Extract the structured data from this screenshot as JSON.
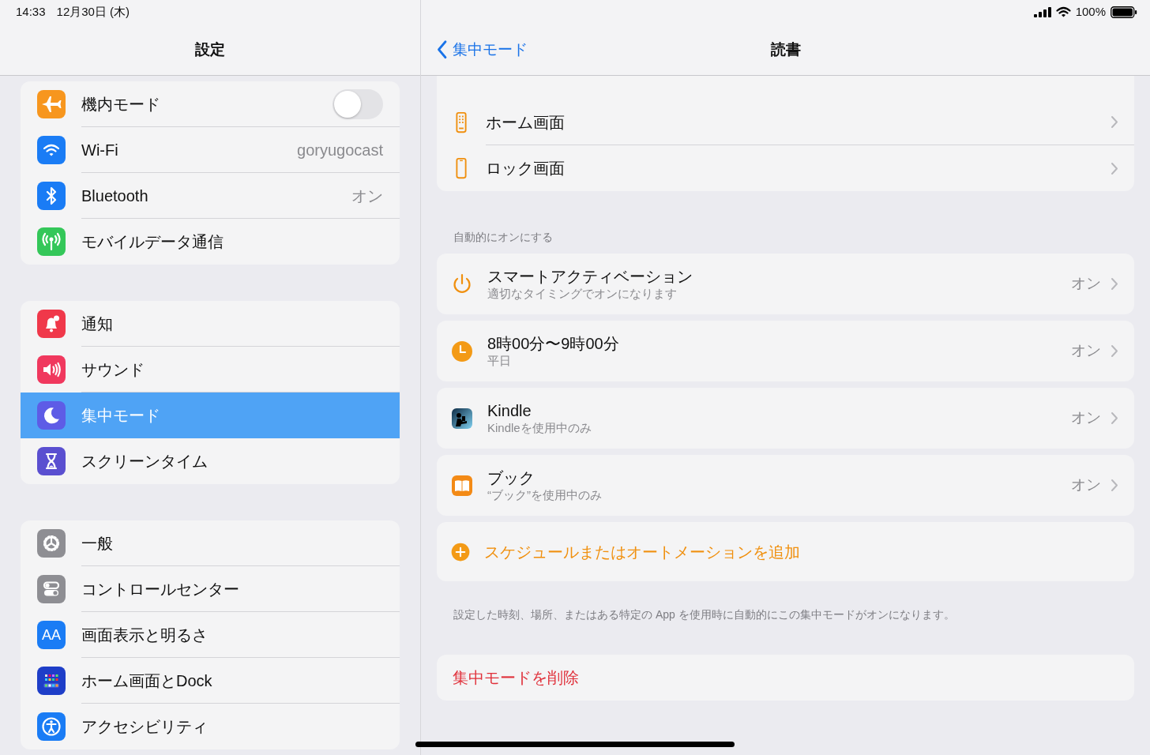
{
  "status_bar": {
    "time": "14:33",
    "date": "12月30日 (木)",
    "battery": "100%"
  },
  "sidebar": {
    "title": "設定",
    "groups": [
      {
        "items": [
          {
            "kind": "toggle",
            "label": "機内モード",
            "on": false,
            "selected": false
          },
          {
            "kind": "link",
            "label": "Wi-Fi",
            "value": "goryugocast",
            "selected": false
          },
          {
            "kind": "link",
            "label": "Bluetooth",
            "value": "オン",
            "selected": false
          },
          {
            "kind": "link",
            "label": "モバイルデータ通信",
            "selected": false
          }
        ]
      },
      {
        "items": [
          {
            "kind": "link",
            "label": "通知",
            "selected": false
          },
          {
            "kind": "link",
            "label": "サウンド",
            "selected": false
          },
          {
            "kind": "link",
            "label": "集中モード",
            "selected": true
          },
          {
            "kind": "link",
            "label": "スクリーンタイム",
            "selected": false
          }
        ]
      },
      {
        "items": [
          {
            "kind": "link",
            "label": "一般",
            "selected": false
          },
          {
            "kind": "link",
            "label": "コントロールセンター",
            "selected": false
          },
          {
            "kind": "link",
            "label": "画面表示と明るさ",
            "icon_text": "AA",
            "selected": false
          },
          {
            "kind": "link",
            "label": "ホーム画面とDock",
            "selected": false
          },
          {
            "kind": "link",
            "label": "アクセシビリティ",
            "selected": false
          }
        ]
      }
    ]
  },
  "detail": {
    "back": "集中モード",
    "title": "読書",
    "top_rows": [
      {
        "label": "ホーム画面"
      },
      {
        "label": "ロック画面"
      }
    ],
    "section_header": "自動的にオンにする",
    "automations": [
      {
        "title": "スマートアクティベーション",
        "subtitle": "適切なタイミングでオンになります",
        "value": "オン"
      },
      {
        "title": "8時00分〜9時00分",
        "subtitle": "平日",
        "value": "オン"
      },
      {
        "title": "Kindle",
        "subtitle": "Kindleを使用中のみ",
        "value": "オン"
      },
      {
        "title": "ブック",
        "subtitle": "“ブック”を使用中のみ",
        "value": "オン"
      }
    ],
    "add_button": "スケジュールまたはオートメーションを追加",
    "footer_note": "設定した時刻、場所、またはある特定の App を使用時に自動的にこの集中モードがオンになります。",
    "delete_button": "集中モードを削除"
  }
}
